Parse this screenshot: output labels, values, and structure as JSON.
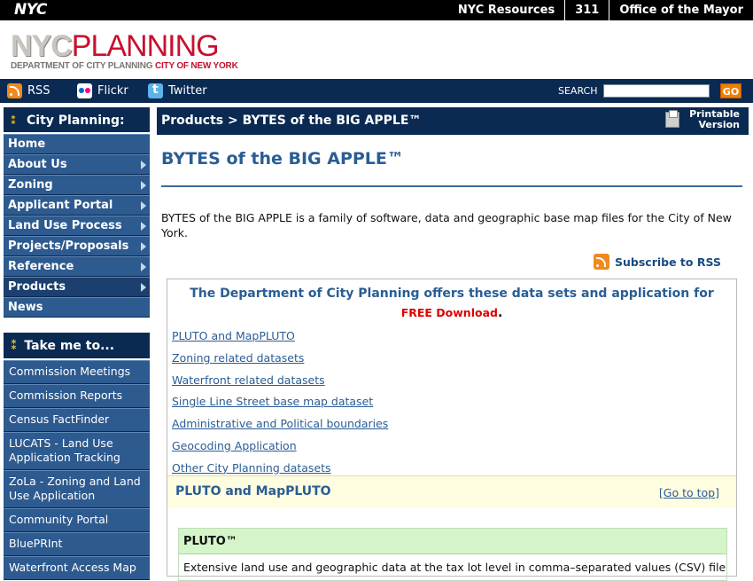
{
  "topbar": {
    "logo": "NYC",
    "links": [
      "NYC Resources",
      "311",
      "Office of the Mayor"
    ]
  },
  "header": {
    "logo_nyc": "NYC",
    "logo_planning": "PLANNING",
    "logo_dept": "DEPARTMENT OF CITY PLANNING",
    "logo_city": "CITY OF NEW YORK"
  },
  "social": {
    "rss": "RSS",
    "flickr": "Flickr",
    "twitter": "Twitter",
    "search_label": "SEARCH",
    "search_value": "",
    "go": "GO",
    "icons": [
      "rss-icon",
      "flickr-icon",
      "twitter-icon"
    ]
  },
  "sidebar": {
    "heading": "City Planning:",
    "items": [
      {
        "label": "Home",
        "arrow": false
      },
      {
        "label": "About Us",
        "arrow": true
      },
      {
        "label": "Zoning",
        "arrow": true
      },
      {
        "label": "Applicant Portal",
        "arrow": true
      },
      {
        "label": "Land Use Process",
        "arrow": true
      },
      {
        "label": "Projects/Proposals",
        "arrow": true
      },
      {
        "label": "Reference",
        "arrow": true
      },
      {
        "label": "Products",
        "arrow": true
      },
      {
        "label": "News",
        "arrow": false
      }
    ],
    "take_heading": "Take me to...",
    "take_items": [
      "Commission Meetings",
      "Commission Reports",
      "Census FactFinder",
      "LUCATS - Land Use Application Tracking",
      "ZoLa - Zoning and Land Use Application",
      "Community Portal",
      "BluePRInt",
      "Waterfront Access Map"
    ]
  },
  "main": {
    "breadcrumb": "Products > BYTES of the BIG APPLE™",
    "printable_line1": "Printable",
    "printable_line2": "Version",
    "title": "BYTES of the BIG APPLE™",
    "intro": "BYTES of the BIG APPLE is a family of software, data and geographic base map files for the City of New York.",
    "subscribe": "Subscribe to RSS",
    "box_heading": "The Department of City Planning offers these data sets and application for",
    "box_free": "FREE Download",
    "box_dot": ".",
    "links": [
      "PLUTO and MapPLUTO",
      "Zoning related datasets",
      "Waterfront related datasets",
      "Single Line Street base map dataset",
      "Administrative and Political boundaries",
      "Geocoding Application",
      "Other City Planning datasets"
    ],
    "section_heading": "PLUTO and MapPLUTO",
    "go_top": "[Go to top]",
    "pluto_title": "PLUTO™",
    "pluto_text": "Extensive land use and geographic data at the tax lot level in comma–separated values (CSV) file"
  },
  "colors": {
    "navy": "#0a2a52",
    "nav_blue": "#2d5a8f",
    "link_blue": "#2a5d94",
    "red": "#c8102e",
    "go_orange": "#f07f00",
    "pluto_green": "#d4f5c8",
    "band_yellow": "#fffde0"
  }
}
